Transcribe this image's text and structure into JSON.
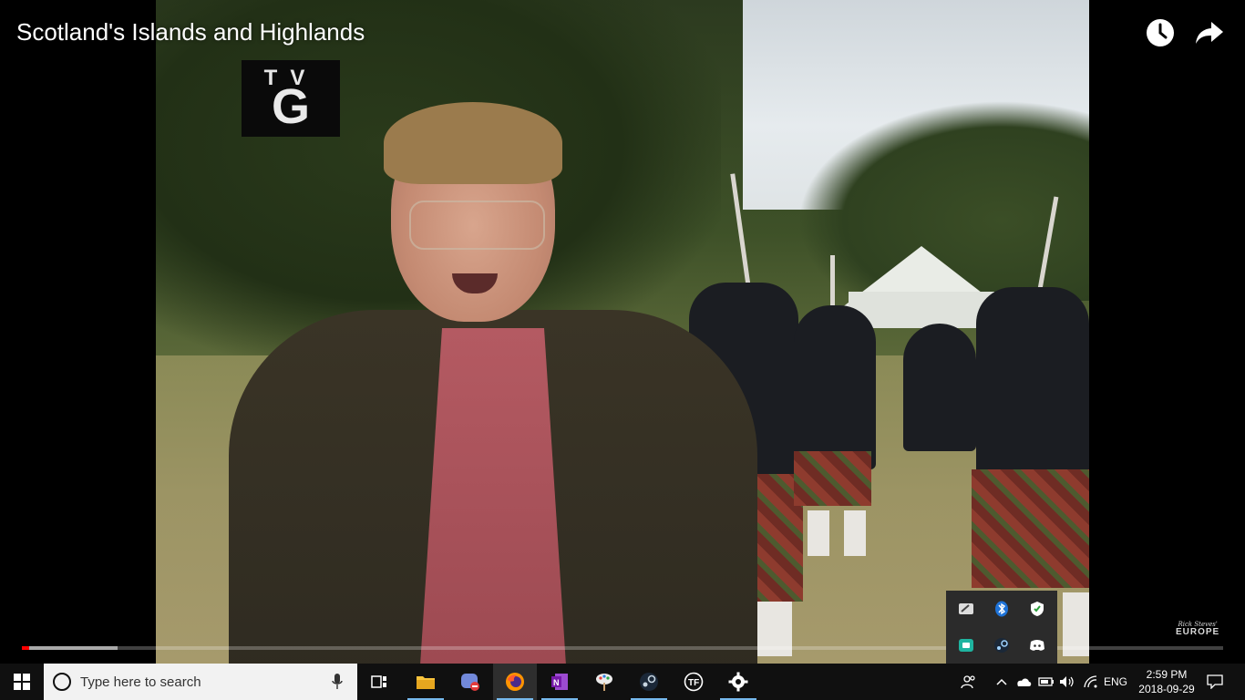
{
  "video": {
    "title": "Scotland's Islands and Highlands",
    "rating_top": "TV",
    "rating_main": "G",
    "watermark_top": "Rick Steves'",
    "watermark_bottom": "EUROPE",
    "progress_loaded_fraction": 0.08,
    "progress_played_fraction": 0.006,
    "accent_color": "#ff0000"
  },
  "top_icons": {
    "watch_later": "clock-icon",
    "share": "share-icon"
  },
  "tray_flyout": {
    "icons": [
      "pen-tablet-icon",
      "bluetooth-icon",
      "defender-shield-icon",
      "app-card-icon",
      "steam-icon",
      "discord-icon"
    ]
  },
  "taskbar": {
    "search_placeholder": "Type here to search",
    "apps": [
      "task-view-icon",
      "file-explorer-icon",
      "discord-app-icon",
      "firefox-icon",
      "onenote-icon",
      "paint-icon",
      "steam-app-icon",
      "tf-icon",
      "settings-icon"
    ],
    "language": "ENG",
    "time": "2:59 PM",
    "date": "2018-09-29"
  }
}
